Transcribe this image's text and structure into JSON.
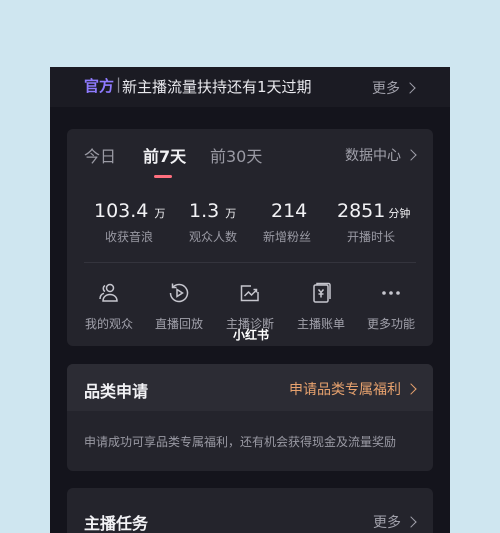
{
  "notice": {
    "tag": "官方",
    "separator": "|",
    "message": "新主播流量扶持还有1天过期",
    "more": "更多"
  },
  "stats_card": {
    "tabs": [
      "今日",
      "前7天",
      "前30天"
    ],
    "active_tab": "前7天",
    "data_center": "数据中心",
    "stats": [
      {
        "value": "103.4",
        "unit": "万",
        "label": "收获音浪"
      },
      {
        "value": "1.3",
        "unit": "万",
        "label": "观众人数"
      },
      {
        "value": "214",
        "unit": "",
        "label": "新增粉丝"
      },
      {
        "value": "2851",
        "unit": "分钟",
        "label": "开播时长"
      }
    ],
    "tools": [
      {
        "label": "我的观众",
        "icon": "audience-icon"
      },
      {
        "label": "直播回放",
        "icon": "replay-icon"
      },
      {
        "label": "主播诊断",
        "icon": "diagnosis-icon"
      },
      {
        "label": "主播账单",
        "icon": "bill-icon"
      },
      {
        "label": "更多功能",
        "icon": "more-dots-icon"
      }
    ]
  },
  "watermark": "小红书",
  "category_card": {
    "title": "品类申请",
    "link": "申请品类专属福利",
    "description": "申请成功可享品类专属福利，还有机会获得现金及流量奖励"
  },
  "task_card": {
    "title": "主播任务",
    "more": "更多"
  },
  "colors": {
    "accent_tag": "#8f7bff",
    "tab_underline": "#ff6f7e",
    "category_link": "#e7a26e",
    "card_background": "#24242c"
  }
}
